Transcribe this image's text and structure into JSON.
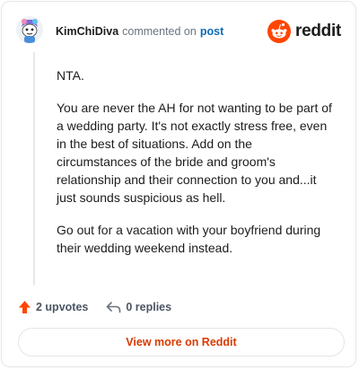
{
  "header": {
    "username": "KimChiDiva",
    "verb": "commented on",
    "post_link": "post",
    "brand": "reddit"
  },
  "comment": {
    "paragraphs": [
      "NTA.",
      "You are never the AH for not wanting to be part of a wedding party. It's not exactly stress free, even in the best of situations. Add on the circumstances of the bride and groom's relationship and their connection to you and...it just sounds suspicious as hell.",
      "Go out for a vacation with your boyfriend during their wedding weekend instead."
    ]
  },
  "actions": {
    "upvotes": "2 upvotes",
    "replies": "0 replies"
  },
  "footer": {
    "view_more": "View more on Reddit"
  },
  "colors": {
    "reddit_orange": "#ff4500",
    "link_blue": "#0a6cb4",
    "button_text": "#d93a00"
  },
  "icons": {
    "avatar": "snoo-avatar",
    "brand": "reddit-logo-icon",
    "upvote": "upvote-arrow-icon",
    "reply": "reply-arrow-icon"
  }
}
